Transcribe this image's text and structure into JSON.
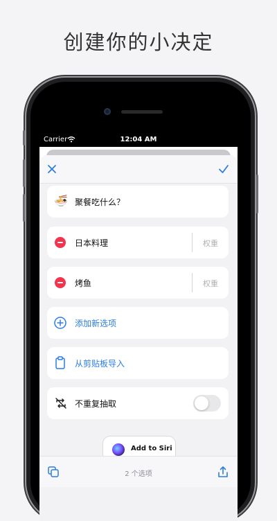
{
  "headline": "创建你的小决定",
  "status_bar": {
    "carrier": "Carrier",
    "time": "12:04 AM"
  },
  "nav": {
    "close_icon": "close-icon",
    "confirm_icon": "checkmark-icon"
  },
  "question": {
    "emoji": "🍜",
    "text": "聚餐吃什么？"
  },
  "options": [
    {
      "label": "日本料理",
      "weight_placeholder": "权重"
    },
    {
      "label": "烤鱼",
      "weight_placeholder": "权重"
    }
  ],
  "add_option": {
    "label": "添加新选项"
  },
  "paste_import": {
    "label": "从剪贴板导入"
  },
  "no_repeat": {
    "label": "不重复抽取",
    "enabled": false
  },
  "siri": {
    "label": "Add to Siri"
  },
  "toolbar": {
    "count_text": "2 个选项",
    "left_icon": "copy-icon",
    "right_icon": "share-icon"
  },
  "colors": {
    "accent": "#2c7de0",
    "remove": "#f2354f"
  }
}
